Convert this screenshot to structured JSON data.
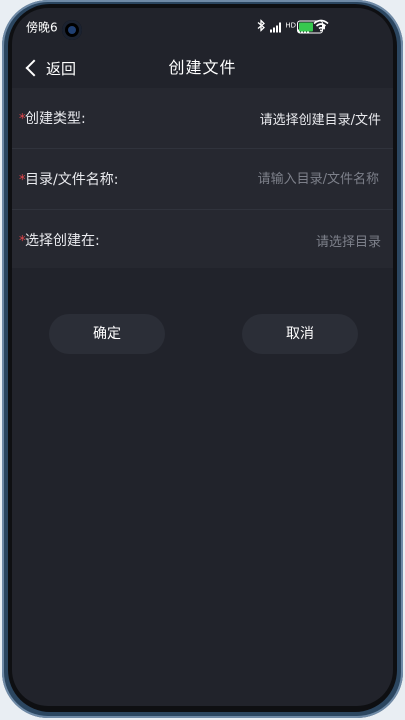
{
  "status": {
    "time": "傍晚6",
    "hd_label": "HD"
  },
  "header": {
    "back_label": "返回",
    "title": "创建文件"
  },
  "form": {
    "required_mark": "*",
    "rows": [
      {
        "label": "创建类型:",
        "value": "请选择创建目录/文件"
      },
      {
        "label": "目录/文件名称:",
        "placeholder": "请输入目录/文件名称"
      },
      {
        "label": "选择创建在:",
        "value": "请选择目录"
      }
    ]
  },
  "actions": {
    "confirm_label": "确定",
    "cancel_label": "取消"
  },
  "colors": {
    "background": "#21232b",
    "form_background": "#262830",
    "required": "#e5484d",
    "button": "#2b2e37",
    "battery": "#37c84f"
  }
}
